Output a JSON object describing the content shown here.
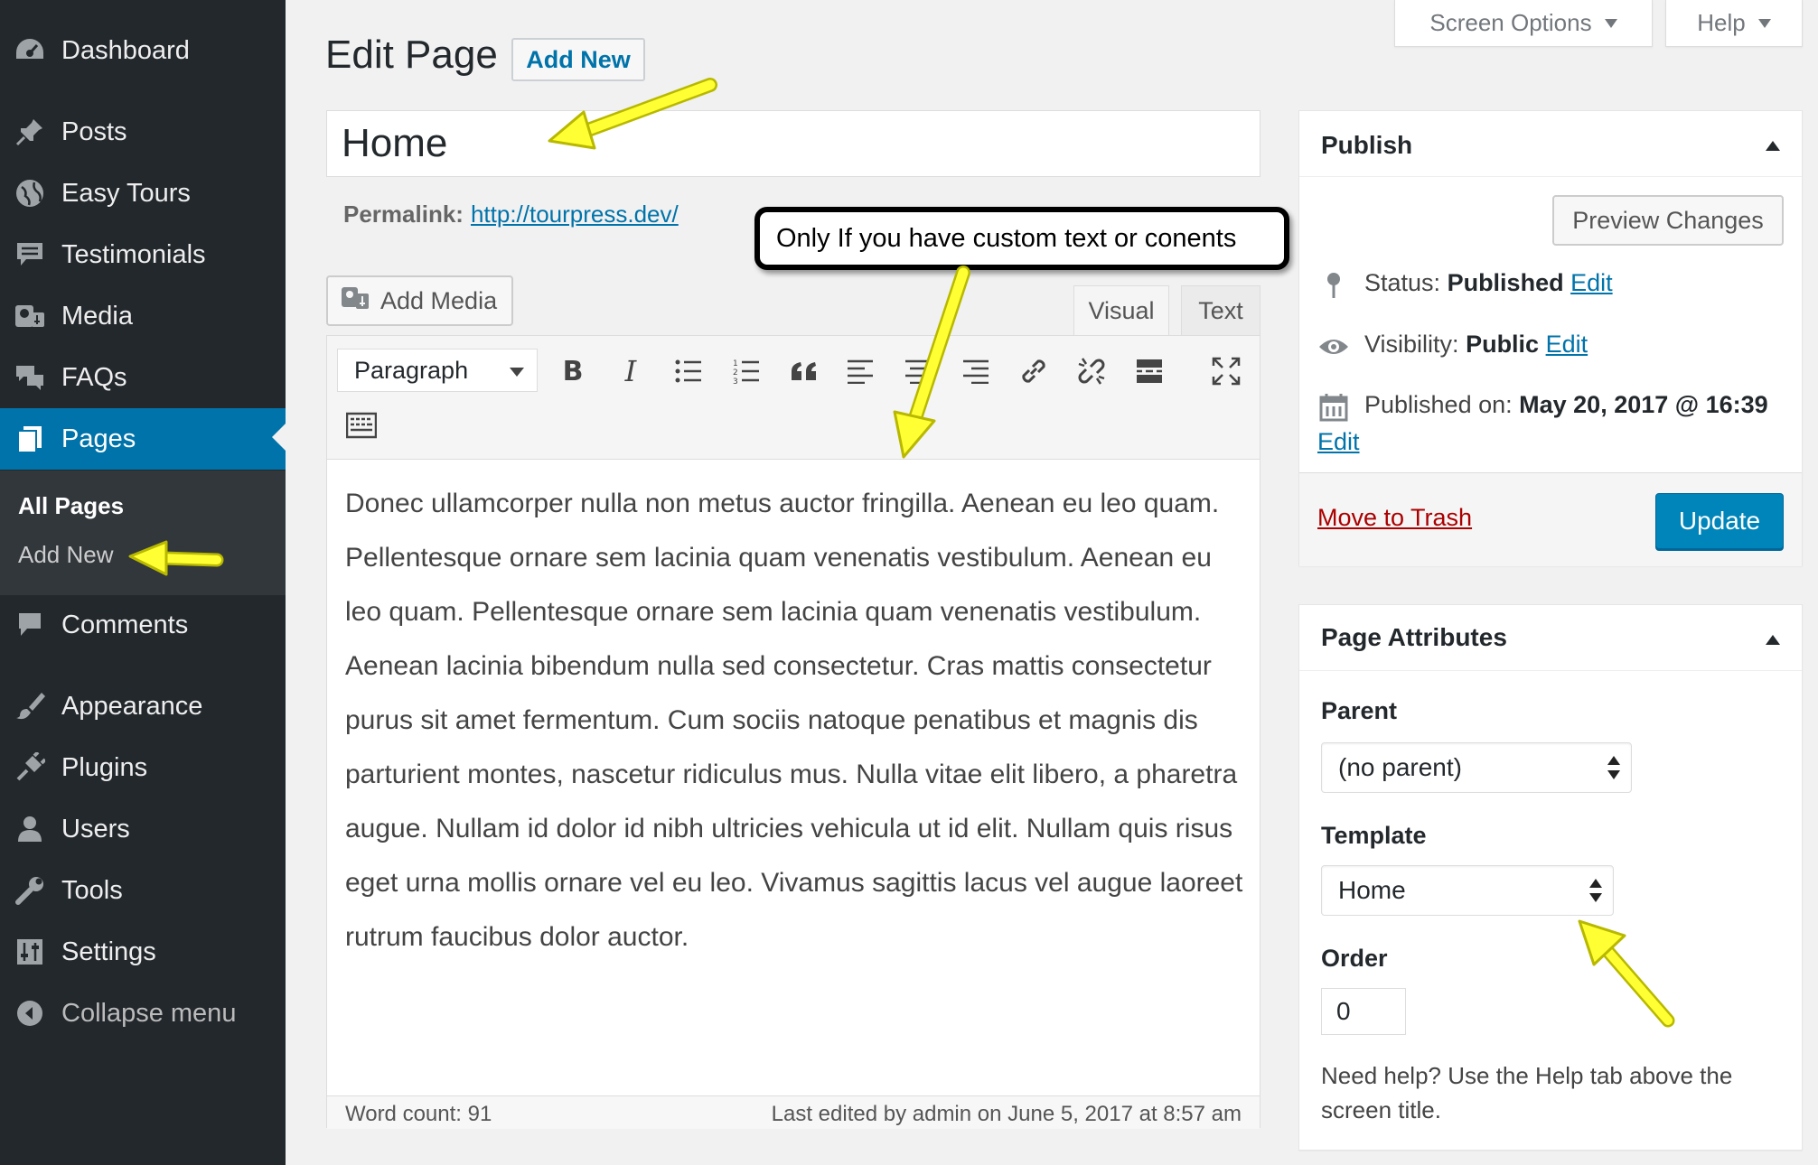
{
  "sidebar": {
    "items": [
      {
        "label": "Dashboard",
        "icon": "dashboard-icon"
      },
      {
        "label": "Posts",
        "icon": "pin-icon"
      },
      {
        "label": "Easy Tours",
        "icon": "globe-icon"
      },
      {
        "label": "Testimonials",
        "icon": "comment-list-icon"
      },
      {
        "label": "Media",
        "icon": "media-icon"
      },
      {
        "label": "FAQs",
        "icon": "chat-bubbles-icon"
      },
      {
        "label": "Pages",
        "icon": "pages-icon"
      },
      {
        "label": "Comments",
        "icon": "comment-icon"
      },
      {
        "label": "Appearance",
        "icon": "paintbrush-icon"
      },
      {
        "label": "Plugins",
        "icon": "plug-icon"
      },
      {
        "label": "Users",
        "icon": "user-icon"
      },
      {
        "label": "Tools",
        "icon": "wrench-icon"
      },
      {
        "label": "Settings",
        "icon": "settings-icon"
      },
      {
        "label": "Collapse menu",
        "icon": "collapse-icon"
      }
    ],
    "submenu": {
      "all_pages": "All Pages",
      "add_new": "Add New"
    }
  },
  "header": {
    "title": "Edit Page",
    "add_new": "Add New",
    "screen_options": "Screen Options",
    "help": "Help"
  },
  "post": {
    "title_value": "Home",
    "permalink_label": "Permalink:",
    "permalink_url": "http://tourpress.dev/"
  },
  "editor": {
    "add_media": "Add Media",
    "tab_visual": "Visual",
    "tab_text": "Text",
    "format": "Paragraph",
    "toolbar": [
      "bold-icon",
      "italic-icon",
      "bullet-list-icon",
      "numbered-list-icon",
      "blockquote-icon",
      "align-left-icon",
      "align-center-icon",
      "align-right-icon",
      "link-icon",
      "unlink-icon",
      "read-more-icon",
      "fullscreen-icon",
      "toolbar-toggle-icon"
    ],
    "content": "Donec ullamcorper nulla non metus auctor fringilla. Aenean eu leo quam. Pellentesque ornare sem lacinia quam venenatis vestibulum. Aenean eu leo quam. Pellentesque ornare sem lacinia quam venenatis vestibulum. Aenean lacinia bibendum nulla sed consectetur. Cras mattis consectetur purus sit amet fermentum. Cum sociis natoque penatibus et magnis dis parturient montes, nascetur ridiculus mus. Nulla vitae elit libero, a pharetra augue. Nullam id dolor id nibh ultricies vehicula ut id elit. Nullam quis risus eget urna mollis ornare vel eu leo. Vivamus sagittis lacus vel augue laoreet rutrum faucibus dolor auctor.",
    "word_count": "Word count: 91",
    "last_edited": "Last edited by admin on June 5, 2017 at 8:57 am"
  },
  "callout": "Only If you have custom text or conents",
  "publish": {
    "title": "Publish",
    "preview": "Preview Changes",
    "status_label": "Status:",
    "status_value": "Published",
    "visibility_label": "Visibility:",
    "visibility_value": "Public",
    "published_label": "Published on:",
    "published_value": "May 20, 2017 @ 16:39",
    "edit": "Edit",
    "trash": "Move to Trash",
    "update": "Update"
  },
  "attributes": {
    "title": "Page Attributes",
    "parent_label": "Parent",
    "parent_value": "(no parent)",
    "template_label": "Template",
    "template_value": "Home",
    "order_label": "Order",
    "order_value": "0",
    "help": "Need help? Use the Help tab above the screen title."
  },
  "colors": {
    "sidebar_bg": "#23282d",
    "active_blue": "#0073aa",
    "button_blue": "#0085ba",
    "annotation_yellow": "#ffff33"
  }
}
